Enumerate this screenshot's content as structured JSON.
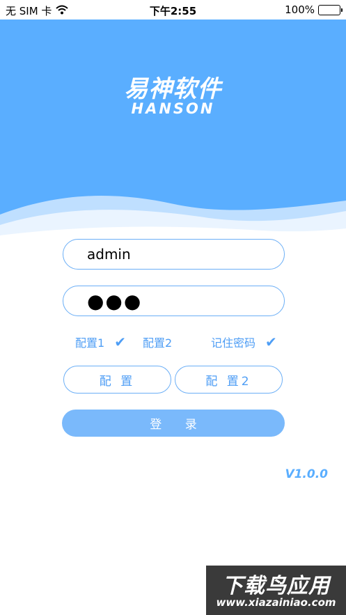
{
  "status_bar": {
    "carrier": "无 SIM 卡",
    "time": "下午2:55",
    "battery": "100%",
    "battery_level": 1.0
  },
  "header": {
    "logo_cn": "易神软件",
    "logo_en": "HANSON",
    "bg_color": "#5aaeff"
  },
  "form": {
    "username_value": "admin",
    "password_value": "●●●",
    "option1_label": "配置1",
    "option2_label": "配置2",
    "remember_label": "记住密码",
    "config_button": "配 置",
    "config2_button": "配 置2",
    "login_button": "登 录"
  },
  "version": "V1.0.0",
  "watermark": {
    "title": "下载鸟应用",
    "url": "www.xiazainiao.com"
  },
  "colors": {
    "accent": "#4f9ef5",
    "login_bg": "#7ab9fb"
  }
}
